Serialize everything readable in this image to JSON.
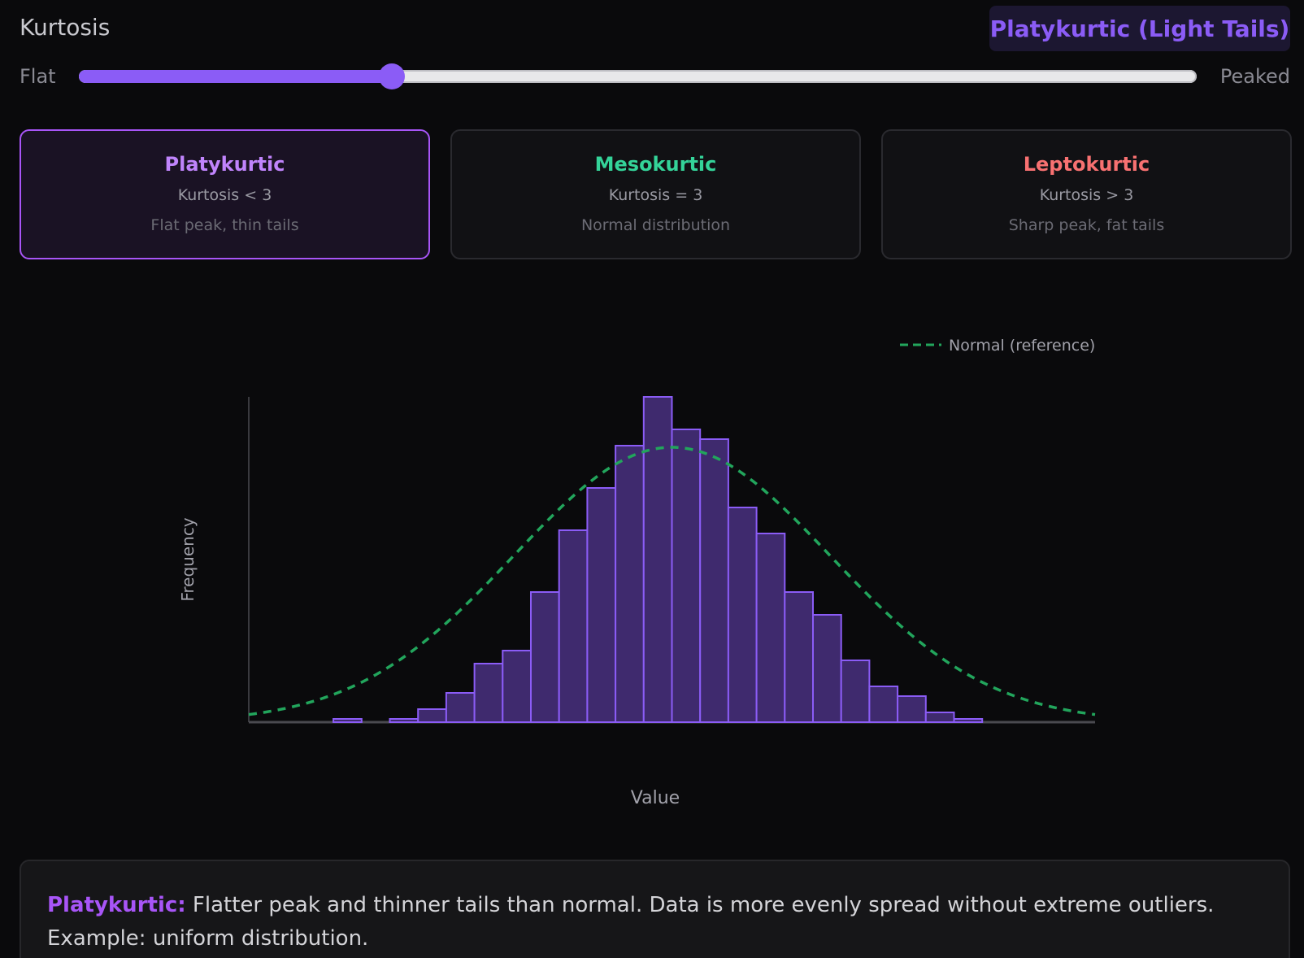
{
  "header": {
    "title": "Kurtosis",
    "badge": "Platykurtic (Light Tails)",
    "badge_color": "#8b5cf6"
  },
  "slider": {
    "left_label": "Flat",
    "right_label": "Peaked",
    "value": 0.28,
    "accent": "#8b5cf6"
  },
  "cards": [
    {
      "title": "Platykurtic",
      "formula": "Kurtosis < 3",
      "desc": "Flat peak, thin tails",
      "color": "#c084fc",
      "active": true
    },
    {
      "title": "Mesokurtic",
      "formula": "Kurtosis = 3",
      "desc": "Normal distribution",
      "color": "#34d399",
      "active": false
    },
    {
      "title": "Leptokurtic",
      "formula": "Kurtosis > 3",
      "desc": "Sharp peak, fat tails",
      "color": "#f87171",
      "active": false
    }
  ],
  "chart_data": {
    "type": "bar",
    "xlabel": "Value",
    "ylabel": "Frequency",
    "legend": {
      "label": "Normal (reference)",
      "position": "top-right"
    },
    "bins": 30,
    "values": [
      0,
      0,
      0,
      1,
      0,
      1,
      4,
      9,
      18,
      22,
      40,
      59,
      72,
      85,
      100,
      90,
      87,
      66,
      58,
      40,
      33,
      19,
      11,
      8,
      3,
      1,
      0,
      0,
      0,
      0
    ],
    "normal_reference": {
      "peak": 84.5,
      "mean_bin": 15,
      "sd_bins": 5.6
    },
    "ylim": [
      0,
      100
    ],
    "grid": false,
    "bar_color": "#3f2a6e",
    "bar_edge": "#8b5cf6",
    "reference_color": "#22a55c"
  },
  "info": {
    "term": "Platykurtic:",
    "text": " Flatter peak and thinner tails than normal. Data is more evenly spread without extreme outliers. Example: uniform distribution."
  }
}
